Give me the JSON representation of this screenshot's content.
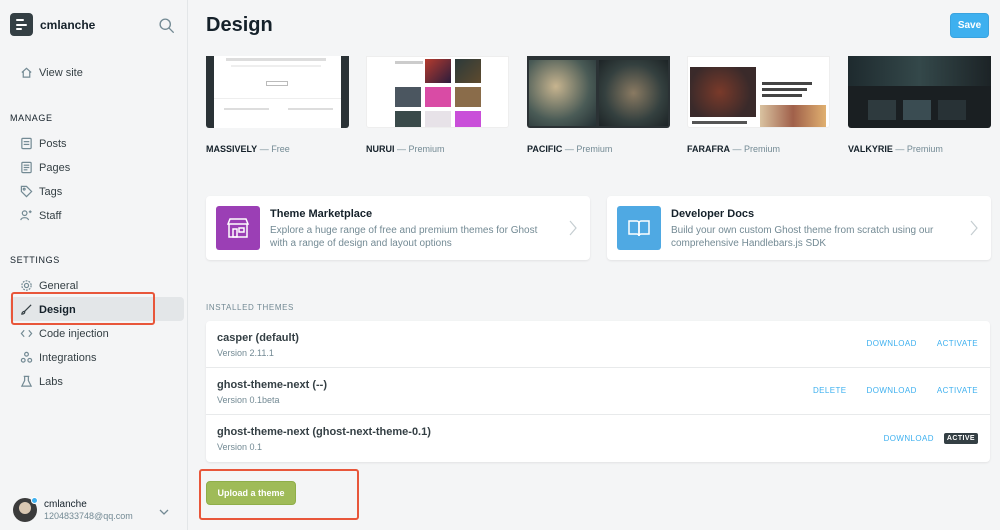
{
  "sidebar": {
    "blog_name": "cmlanche",
    "view_site_label": "View site",
    "manage_title": "MANAGE",
    "manage_items": [
      {
        "label": "Posts",
        "icon": "posts-icon"
      },
      {
        "label": "Pages",
        "icon": "pages-icon"
      },
      {
        "label": "Tags",
        "icon": "tag-icon"
      },
      {
        "label": "Staff",
        "icon": "staff-icon"
      }
    ],
    "settings_title": "SETTINGS",
    "settings_items": [
      {
        "label": "General",
        "icon": "gear-icon"
      },
      {
        "label": "Design",
        "icon": "brush-icon",
        "active": true
      },
      {
        "label": "Code injection",
        "icon": "code-icon"
      },
      {
        "label": "Integrations",
        "icon": "integrations-icon"
      },
      {
        "label": "Labs",
        "icon": "labs-icon"
      }
    ],
    "user": {
      "name": "cmlanche",
      "email": "1204833748@qq.com"
    }
  },
  "header": {
    "title": "Design",
    "save_label": "Save"
  },
  "marketplace_themes": [
    {
      "name": "MASSIVELY",
      "price": "— Free"
    },
    {
      "name": "NURUI",
      "price": "— Premium"
    },
    {
      "name": "PACIFIC",
      "price": "— Premium"
    },
    {
      "name": "FARAFRA",
      "price": "— Premium"
    },
    {
      "name": "VALKYRIE",
      "price": "— Premium"
    }
  ],
  "cards": {
    "marketplace": {
      "title": "Theme Marketplace",
      "desc": "Explore a huge range of free and premium themes for Ghost with a range of design and layout options"
    },
    "docs": {
      "title": "Developer Docs",
      "desc": "Build your own custom Ghost theme from scratch using our comprehensive Handlebars.js SDK"
    }
  },
  "installed": {
    "title": "INSTALLED THEMES",
    "themes": [
      {
        "name": "casper (default)",
        "version": "Version 2.11.1",
        "download": "DOWNLOAD",
        "activate": "ACTIVATE"
      },
      {
        "name": "ghost-theme-next (--)",
        "version": "Version 0.1beta",
        "delete": "DELETE",
        "download": "DOWNLOAD",
        "activate": "ACTIVATE"
      },
      {
        "name": "ghost-theme-next (ghost-next-theme-0.1)",
        "version": "Version 0.1",
        "download": "DOWNLOAD",
        "badge": "ACTIVE"
      }
    ]
  },
  "upload_label": "Upload a theme",
  "colors": {
    "accent": "#3eb0ef",
    "upload": "#9fbb58",
    "highlight": "#e8563a",
    "marketplace_icon": "#9b3fb5",
    "docs_icon": "#4fa9e3"
  }
}
